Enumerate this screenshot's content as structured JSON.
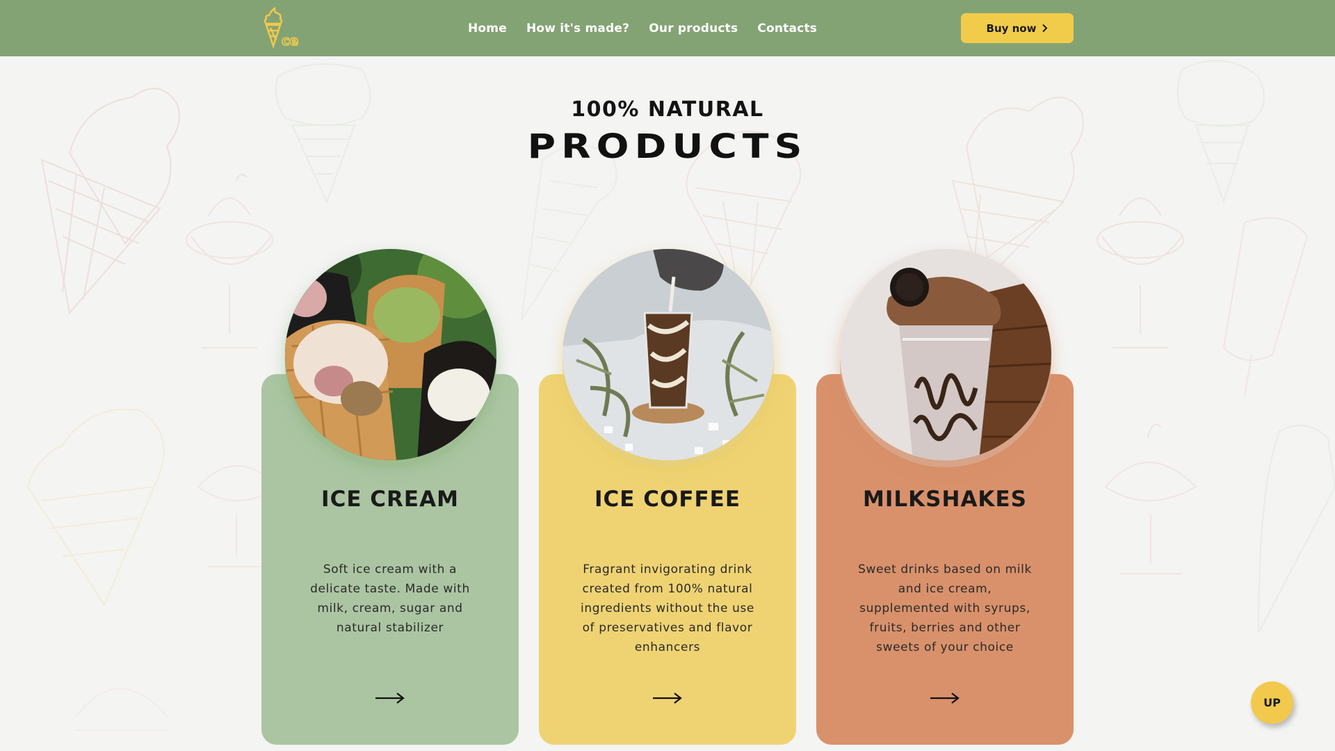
{
  "nav": {
    "logo_text": "ce",
    "links": [
      "Home",
      "How it's made?",
      "Our products",
      "Contacts"
    ],
    "buy_label": "Buy now",
    "buy_icon": "chevron-right-icon"
  },
  "section": {
    "subtitle": "100% NATURAL",
    "title": "PRODUCTS"
  },
  "cards": [
    {
      "title": "ICE CREAM",
      "lines": [
        "Soft ice cream with a",
        "delicate taste. Made with",
        "milk, cream, sugar and",
        "natural stabilizer"
      ],
      "color": "#abc5a2",
      "image": "ice-cream-waffle-cones-photo"
    },
    {
      "title": "ICE COFFEE",
      "lines": [
        "Fragrant invigorating drink",
        "created from 100% natural",
        "ingredients without the use",
        "of preservatives and flavor",
        "enhancers"
      ],
      "color": "#efd373",
      "image": "iced-coffee-glass-photo"
    },
    {
      "title": "MILKSHAKES",
      "lines": [
        "Sweet drinks based on milk",
        "and ice cream,",
        "supplemented with syrups,",
        "fruits, berries and other",
        "sweets of your choice"
      ],
      "color": "#d9916b",
      "image": "milkshake-cup-photo"
    }
  ],
  "up_label": "UP",
  "colors": {
    "nav_bg": "#84a374",
    "accent": "#f1cc4b",
    "page_bg": "#f4f4f3"
  }
}
